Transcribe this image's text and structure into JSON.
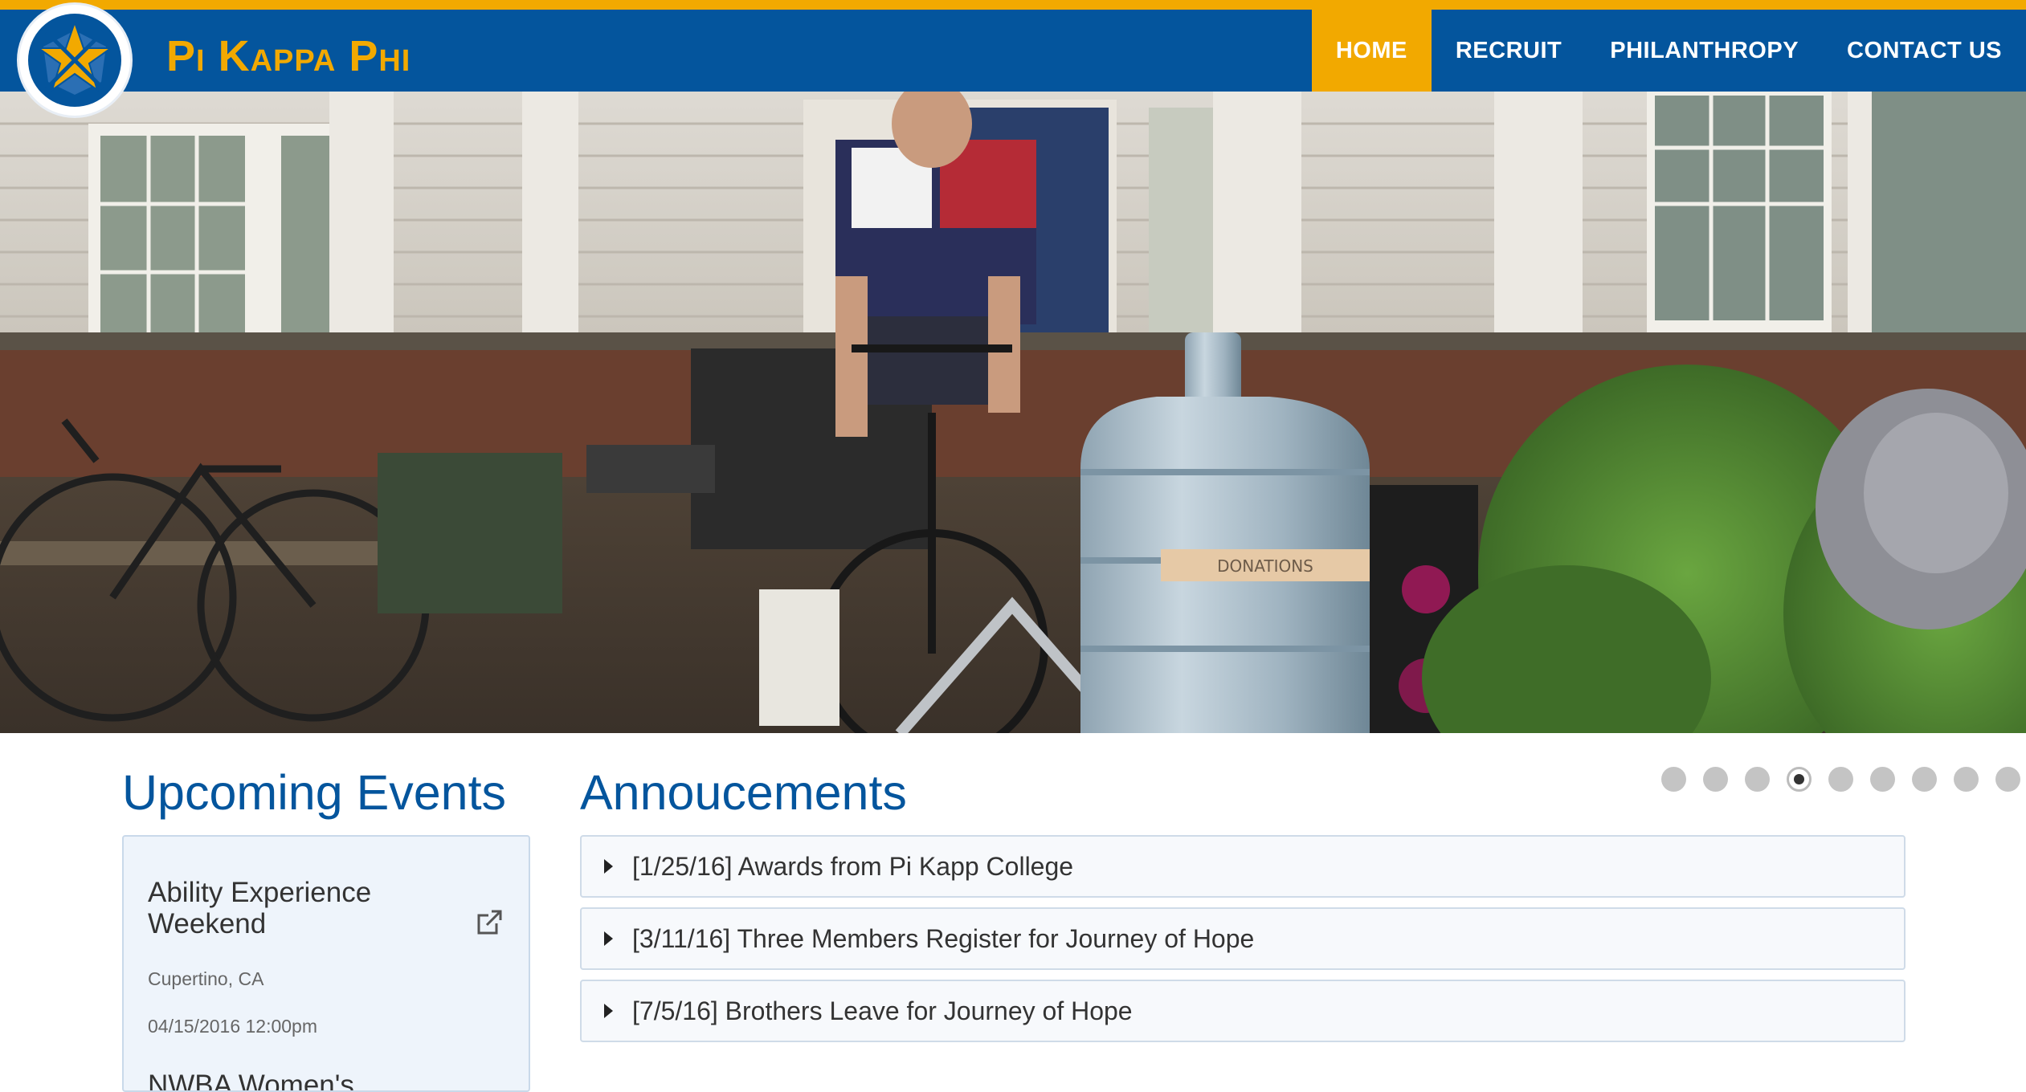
{
  "colors": {
    "brand_blue": "#04559d",
    "brand_gold": "#f2a900"
  },
  "header": {
    "site_name": "Pi Kappa Phi",
    "logo_icon": "star-shield-logo-icon"
  },
  "nav": {
    "items": [
      {
        "label": "HOME",
        "active": true
      },
      {
        "label": "RECRUIT",
        "active": false
      },
      {
        "label": "PHILANTHROPY",
        "active": false
      },
      {
        "label": "CONTACT US",
        "active": false
      }
    ]
  },
  "hero": {
    "jar_label": "DONATIONS"
  },
  "carousel": {
    "slide_count": 9,
    "active_index": 3
  },
  "events": {
    "title": "Upcoming Events",
    "items": [
      {
        "name": "Ability Experience Weekend",
        "location": "Cupertino, CA",
        "datetime": "04/15/2016 12:00pm",
        "link_icon": "external-link-icon"
      },
      {
        "name": "NWBA Women's"
      }
    ]
  },
  "announcements": {
    "title": "Annoucements",
    "items": [
      {
        "label": "[1/25/16] Awards from Pi Kapp College"
      },
      {
        "label": "[3/11/16] Three Members Register for Journey of Hope"
      },
      {
        "label": "[7/5/16] Brothers Leave for Journey of Hope"
      }
    ]
  }
}
